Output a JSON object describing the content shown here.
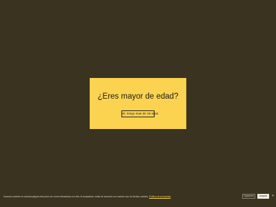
{
  "age_gate": {
    "question": "¿Eres mayor de edad?",
    "confirm_label": "Sí, tengo mas de 18 años"
  },
  "cookie_banner": {
    "text": "Usamos cookies en nuestra página web para ver cómo interactúas con ella. Al aceptarlas, estás de acuerdo con nuestro uso de dichas cookies.",
    "policy_link": "Política de privacidad",
    "options_label": "Opciones",
    "accept_label": "Aceptar",
    "close_icon": "close-icon"
  },
  "colors": {
    "background": "#3a3320",
    "modal": "#fcd351",
    "text_dark": "#1d1a12",
    "link": "#fcd351"
  }
}
